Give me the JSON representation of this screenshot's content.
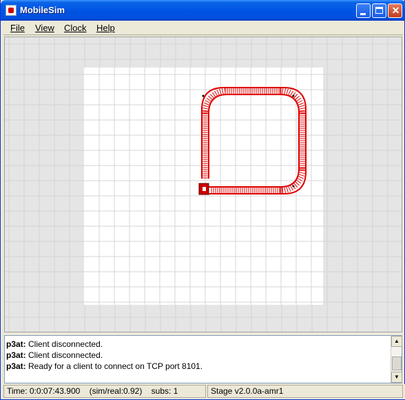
{
  "window": {
    "title": "MobileSim"
  },
  "menu": [
    "File",
    "View",
    "Clock",
    "Help"
  ],
  "log": [
    {
      "source": "p3at:",
      "message": "Client disconnected."
    },
    {
      "source": "p3at:",
      "message": "Client disconnected."
    },
    {
      "source": "p3at:",
      "message": "Ready for a client to connect on TCP port 8101."
    }
  ],
  "status": {
    "time": "Time: 0:0:07:43.900",
    "ratio": "(sim/real:0.92)",
    "subs": "subs: 1",
    "version": "Stage v2.0.0a-amr1"
  },
  "colors": {
    "trail": "#e00000",
    "robot": "#cc0000",
    "grid": "#d4d4d4",
    "map": "#ffffff"
  }
}
